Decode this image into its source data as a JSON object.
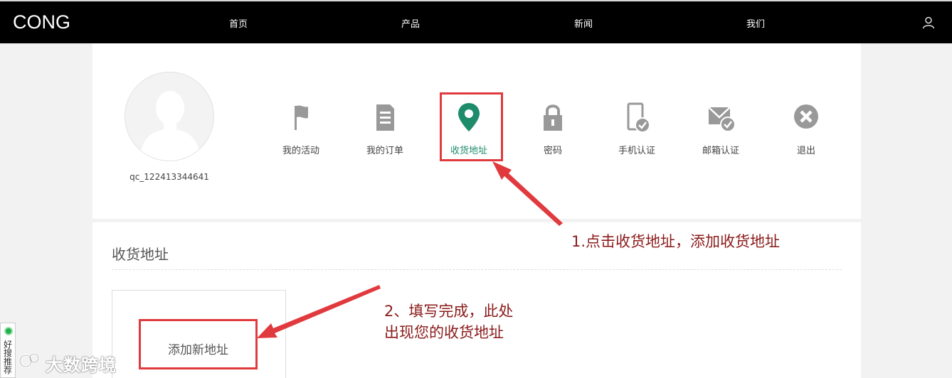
{
  "brand": {
    "logo": "CONG"
  },
  "nav": {
    "items": [
      "首页",
      "产品",
      "新闻",
      "我们"
    ]
  },
  "profile": {
    "username": "qc_122413344641"
  },
  "menu": [
    {
      "label": "我的活动",
      "icon": "flag-icon"
    },
    {
      "label": "我的订单",
      "icon": "document-icon"
    },
    {
      "label": "收货地址",
      "icon": "location-pin-icon",
      "active": true
    },
    {
      "label": "密码",
      "icon": "lock-icon"
    },
    {
      "label": "手机认证",
      "icon": "phone-verified-icon"
    },
    {
      "label": "邮箱认证",
      "icon": "email-verified-icon"
    },
    {
      "label": "退出",
      "icon": "close-circle-icon"
    }
  ],
  "address_section": {
    "title": "收货地址",
    "add_button": "添加新地址"
  },
  "annotations": {
    "step1": "1.点击收货地址，添加收货地址",
    "step2_line1": "2、填写完成，此处",
    "step2_line2": "出现您的收货地址"
  },
  "side_widget": {
    "text": "好搜推荐"
  },
  "watermark": {
    "text": "大数跨境"
  },
  "colors": {
    "accent": "#1e8b6a",
    "highlight": "#e03a3e",
    "annotation": "#8b1a1a",
    "topbar": "#000000"
  }
}
